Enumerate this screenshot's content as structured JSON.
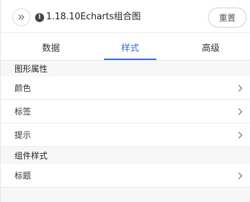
{
  "header": {
    "back_icon": "double-chevron-right-icon",
    "info_icon": "info-circle-icon",
    "title": "1.18.10Echarts组合图",
    "reset_label": "重置"
  },
  "tabs": [
    {
      "label": "数据",
      "active": false
    },
    {
      "label": "样式",
      "active": true
    },
    {
      "label": "高级",
      "active": false
    }
  ],
  "accent_color": "#2f6fd6",
  "sections": [
    {
      "title": "图形属性",
      "items": [
        {
          "label": "颜色",
          "icon": "chevron-right-icon"
        },
        {
          "label": "标签",
          "icon": "chevron-right-icon"
        },
        {
          "label": "提示",
          "icon": "chevron-right-icon"
        }
      ]
    },
    {
      "title": "组件样式",
      "items": [
        {
          "label": "标题",
          "icon": "chevron-right-icon"
        }
      ]
    }
  ]
}
